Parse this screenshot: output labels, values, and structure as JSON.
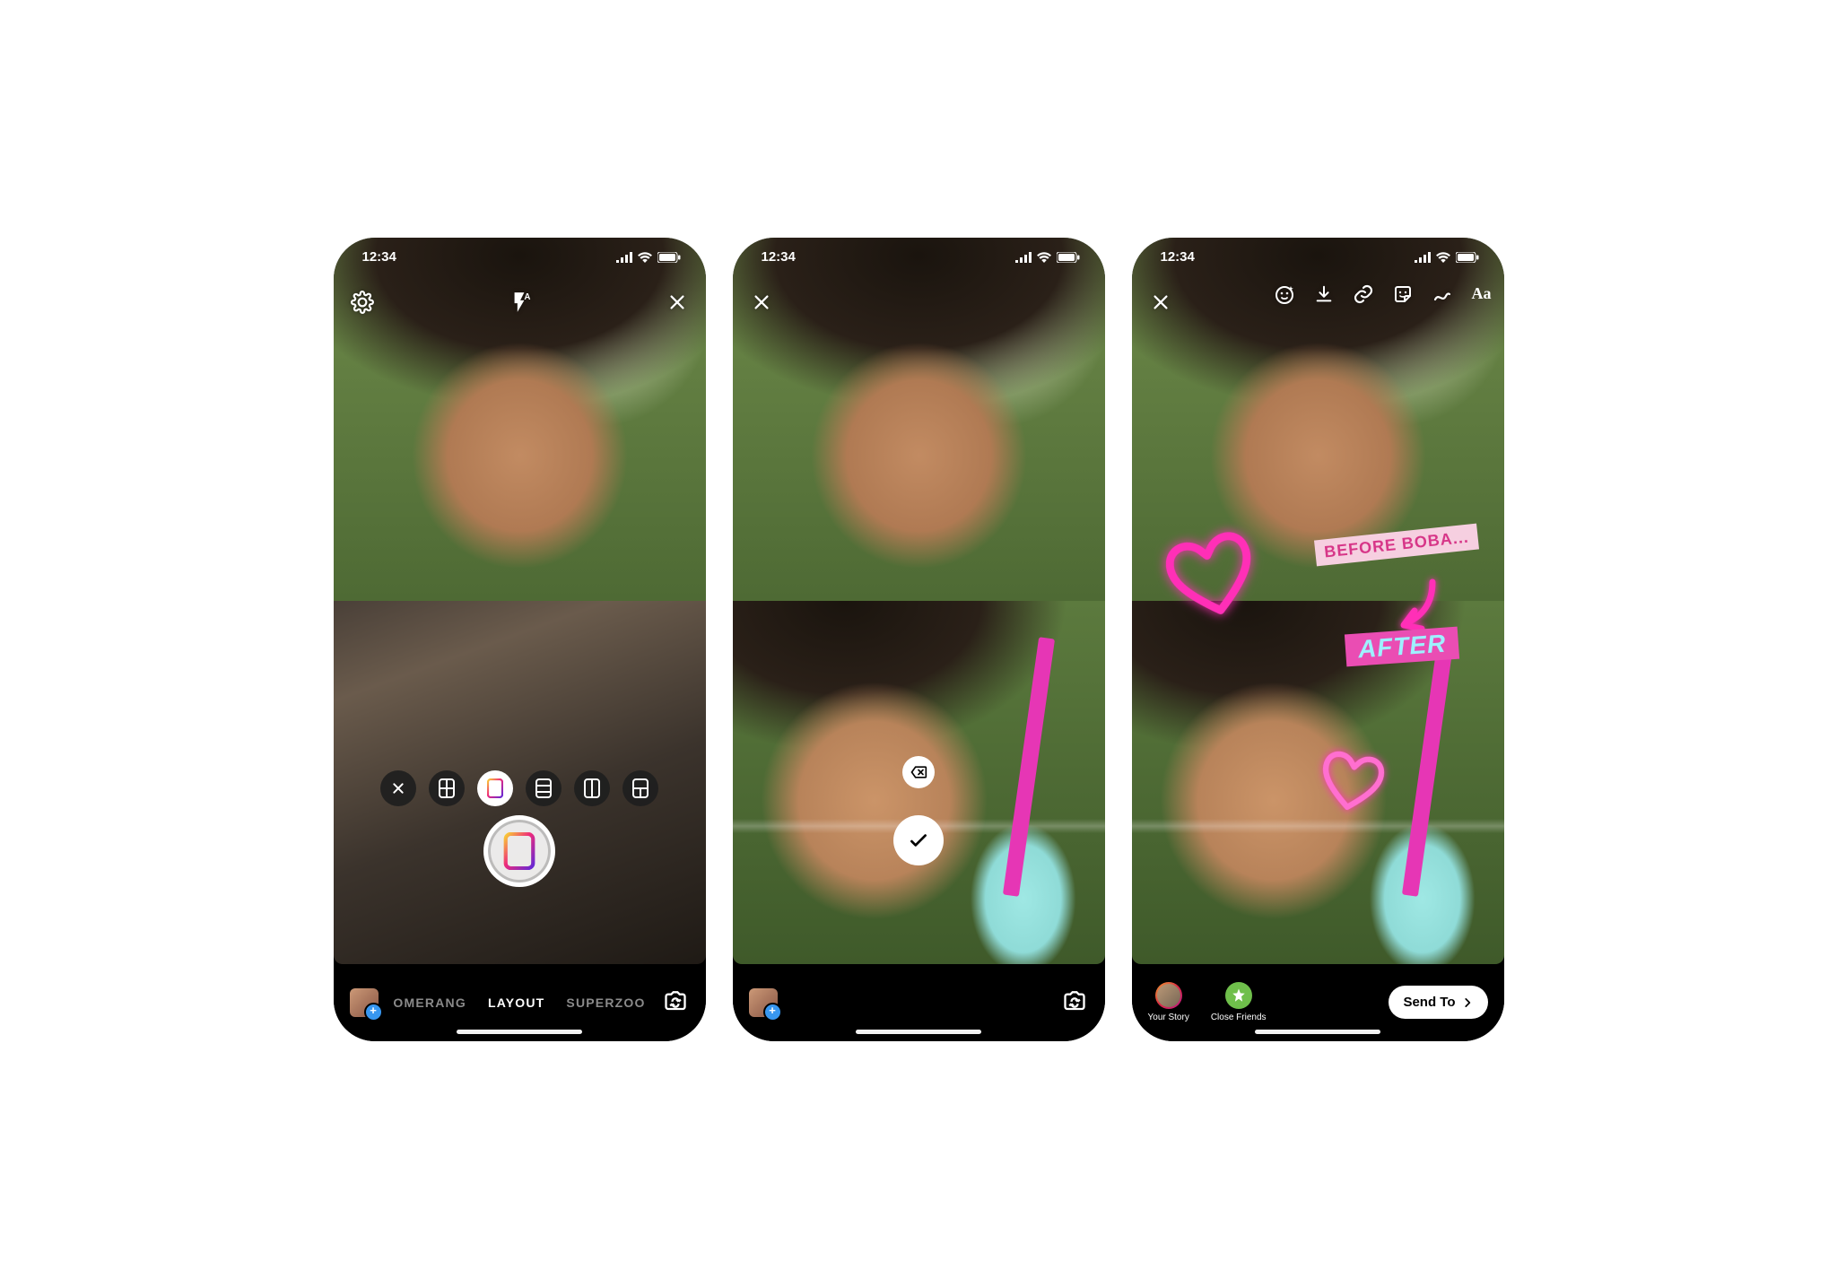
{
  "status": {
    "time": "12:34"
  },
  "screen1": {
    "modes": {
      "prev": "OMERANG",
      "active": "LAYOUT",
      "next": "SUPERZOO"
    },
    "layout_options": [
      "close",
      "grid-2x2",
      "split-h",
      "split-h-alt",
      "split-v",
      "grid-3"
    ],
    "selected_layout_index": 2
  },
  "screen3": {
    "sticker_before": "BEFORE BOBA...",
    "sticker_after": "AFTER",
    "share": {
      "your_story": "Your Story",
      "close_friends": "Close Friends",
      "send_to": "Send To"
    },
    "tools": [
      "effects",
      "download",
      "link",
      "sticker",
      "draw",
      "text"
    ]
  }
}
